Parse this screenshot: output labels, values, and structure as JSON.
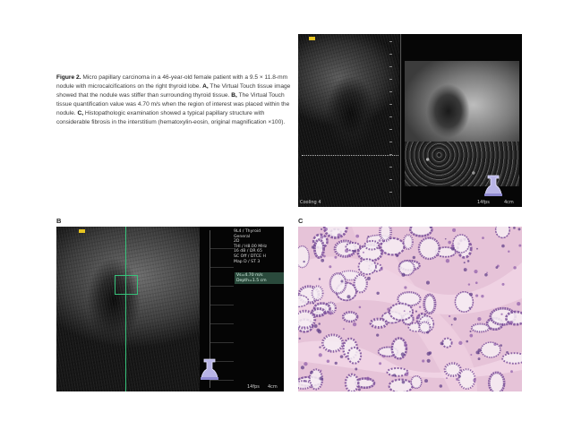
{
  "caption": {
    "figure_label": "Figure 2.",
    "body": "Micro papillary carcinoma in a 46-year-old female patient with a 9.5 × 11.8-mm nodule with microcalcifications on the right thyroid lobe.",
    "a_label": "A,",
    "a_text": "The Virtual Touch tissue image showed that the nodule was stiffer than surrounding thyroid tissue.",
    "b_label": "B,",
    "b_text": "The Virtual Touch tissue quantification value was 4.70 m/s when the region of interest was placed within the nodule.",
    "c_label": "C,",
    "c_text": "Histopathologic examination showed a typical papillary structure with considerable fibrosis in the interstitium (hematoxylin-eosin, original magnification ×100)."
  },
  "panel_labels": {
    "b": "B",
    "c": "C"
  },
  "panel_a": {
    "bottom_left": "Cooling 4",
    "fps": "14fps",
    "depth": "4cm"
  },
  "panel_b": {
    "info_lines": [
      "9L4 / Thyroid",
      "General",
      "2D",
      "THI / H8.00 MHz",
      "16 dB / DR 65",
      "SC Off / DTCE H",
      "Map D / ST 3"
    ],
    "vs_lines": [
      "Vs=4.70 m/s",
      "Depth=1.5 cm"
    ],
    "fps": "14fps",
    "depth": "4cm"
  },
  "colors": {
    "roi_green": "#37c27a",
    "tag_yellow": "#e6c421",
    "he_background": "#e8c9dc"
  }
}
